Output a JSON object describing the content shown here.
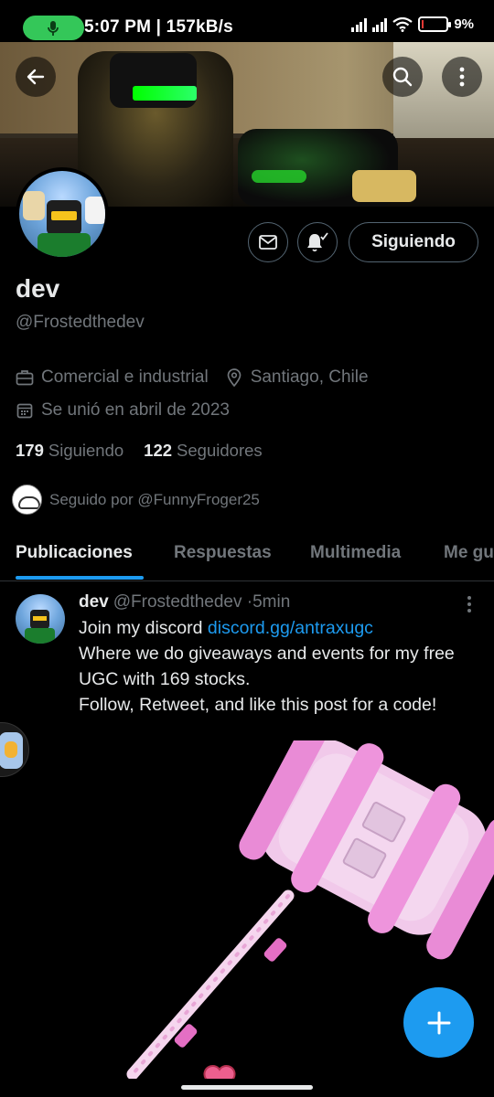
{
  "status_bar": {
    "time_and_speed": "5:07 PM | 157kB/s",
    "battery_percent": "9%",
    "battery_level": 0.09
  },
  "colors": {
    "accent": "#1d9bf0",
    "background": "#000000",
    "text_primary": "#e7e9ea",
    "text_secondary": "#71767b",
    "mic_indicator": "#34c759"
  },
  "header": {
    "back_icon": "arrow-left-icon",
    "search_icon": "search-icon",
    "more_icon": "more-vertical-icon"
  },
  "profile": {
    "display_name": "dev",
    "handle": "@Frostedthedev",
    "category": "Comercial e industrial",
    "location": "Santiago, Chile",
    "joined": "Se unió en abril de 2023",
    "following_count": "179",
    "following_label": "Siguiendo",
    "followers_count": "122",
    "followers_label": "Seguidores",
    "followed_by": "Seguido por @FunnyFroger25",
    "follow_button_label": "Siguiendo"
  },
  "tabs": [
    {
      "label": "Publicaciones",
      "active": true
    },
    {
      "label": "Respuestas",
      "active": false
    },
    {
      "label": "Multimedia",
      "active": false
    },
    {
      "label": "Me gu",
      "active": false
    }
  ],
  "post": {
    "name": "dev",
    "handle": "@Frostedthedev",
    "separator": "·",
    "time": "5min",
    "line1_text": "Join my discord ",
    "line1_link": "discord.gg/antraxugc",
    "line2": "Where we do giveaways and events for my free",
    "line3": "UGC with 169 stocks.",
    "line4": "Follow, Retweet, and like this post for a code!"
  },
  "fab": {
    "icon": "plus-icon"
  }
}
